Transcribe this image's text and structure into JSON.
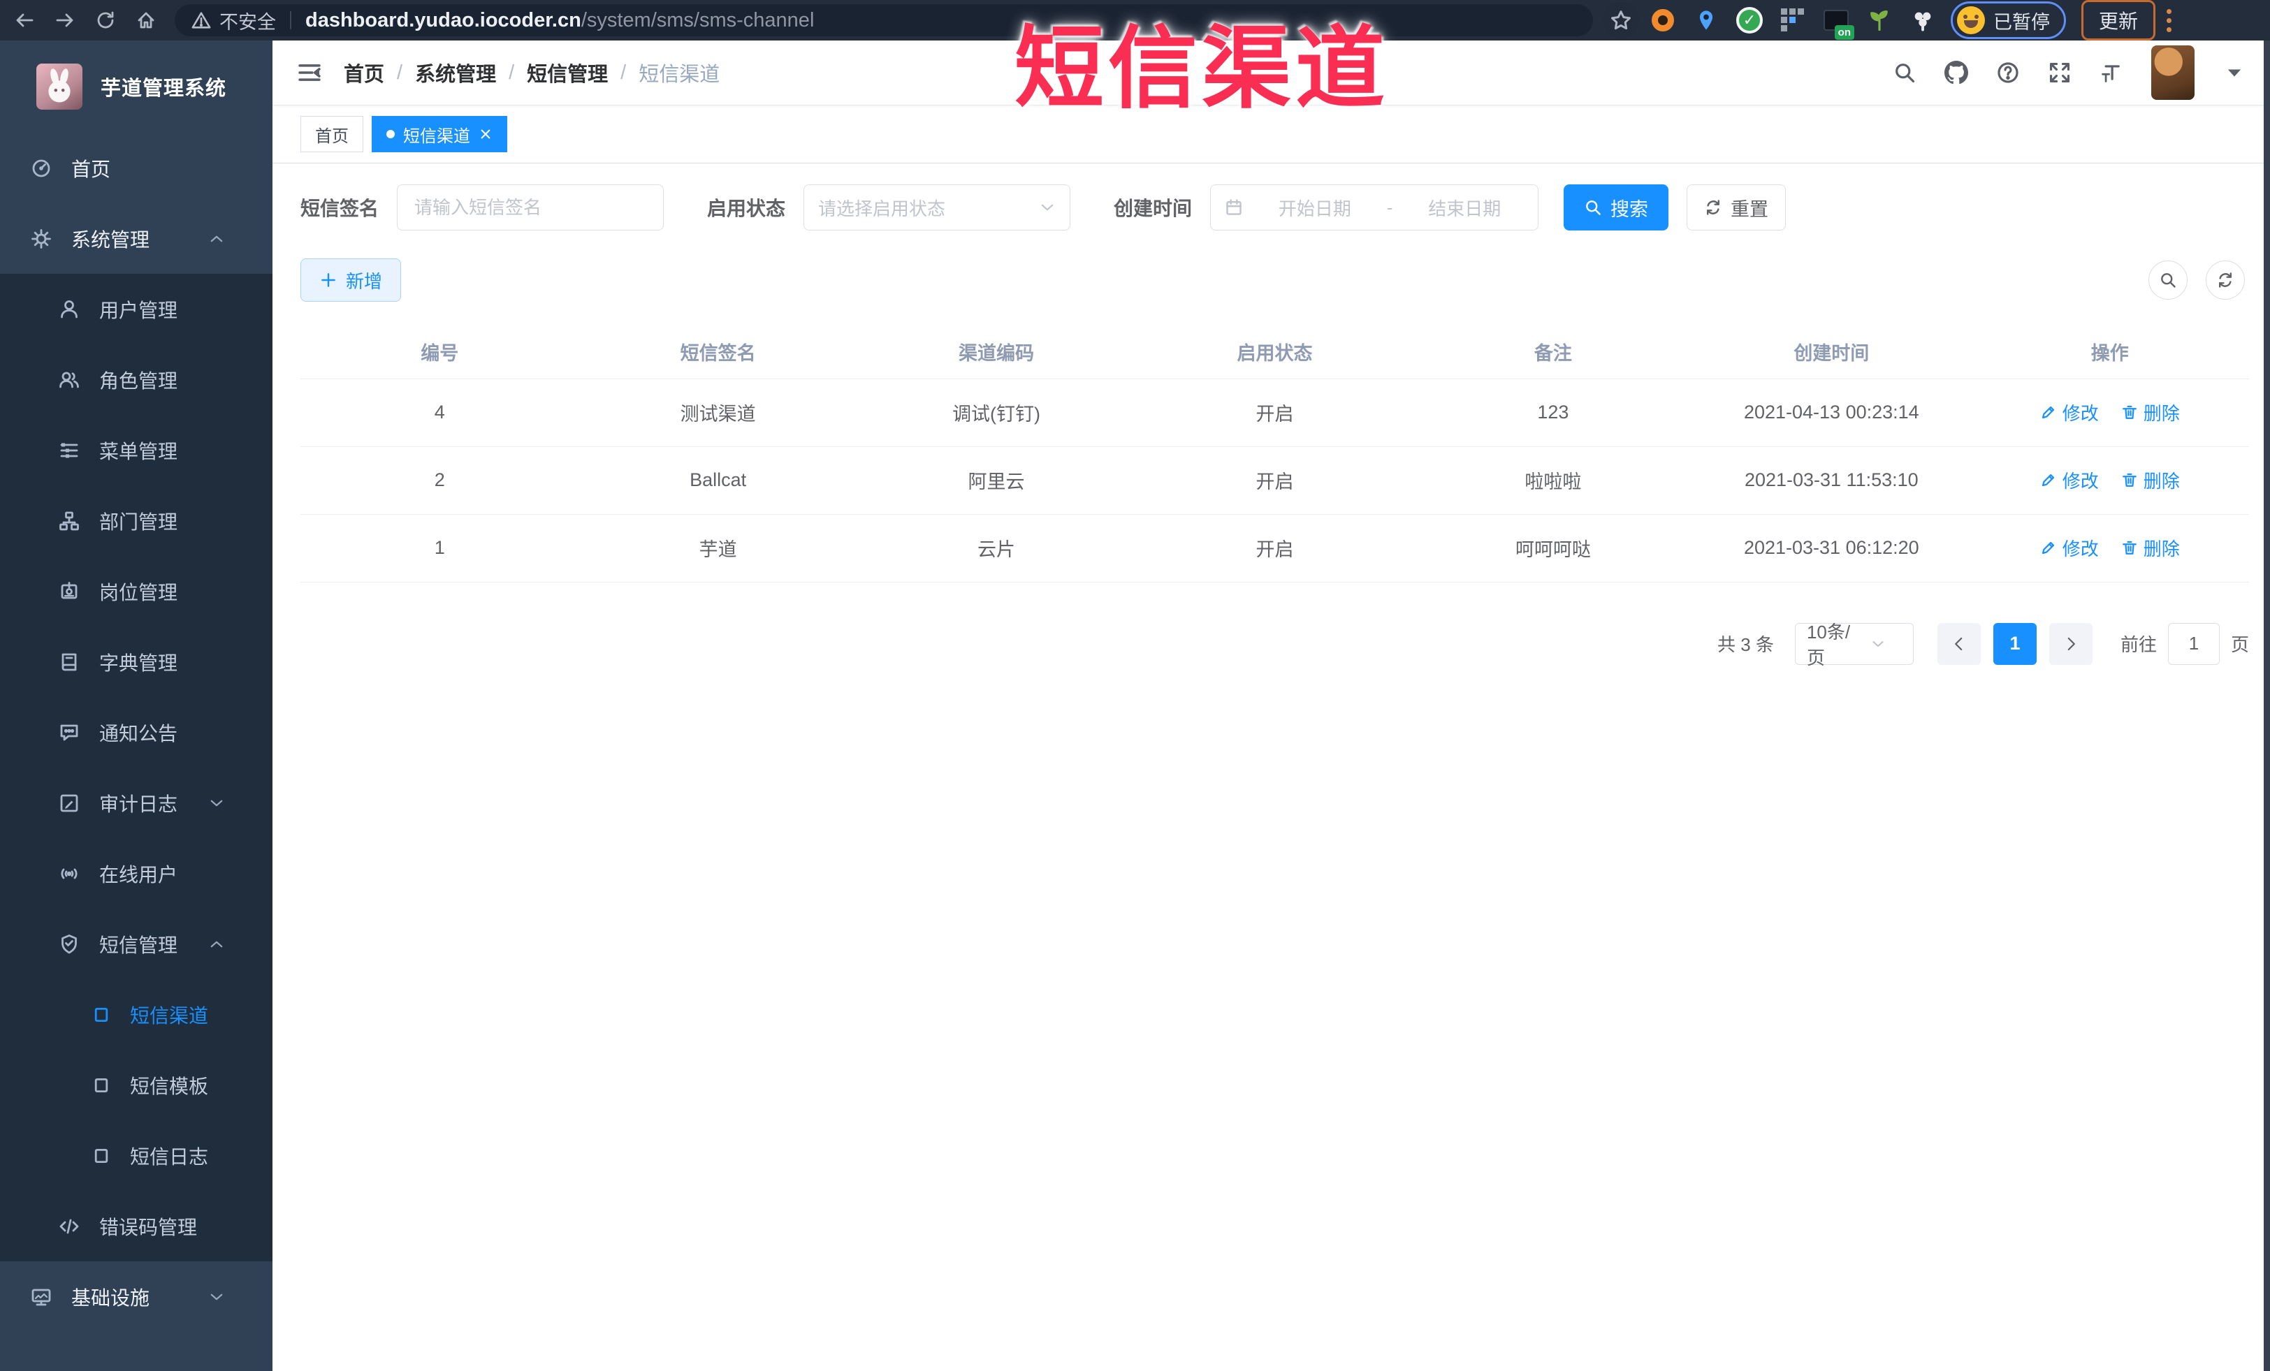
{
  "browser": {
    "security_label": "不安全",
    "url_host": "dashboard.yudao.iocoder.cn",
    "url_path": "/system/sms/sms-channel",
    "paused_badge": "已暂停",
    "update_button": "更新",
    "extension_on_badge": "on"
  },
  "annotation": {
    "text": "短信渠道"
  },
  "sidebar": {
    "title": "芋道管理系统",
    "items": [
      {
        "label": "首页",
        "icon": "dashboard",
        "level": 1
      },
      {
        "label": "系统管理",
        "icon": "gear",
        "level": 1,
        "chevron": "up"
      },
      {
        "label": "用户管理",
        "icon": "user",
        "level": 2
      },
      {
        "label": "角色管理",
        "icon": "peoples",
        "level": 2
      },
      {
        "label": "菜单管理",
        "icon": "tree-table",
        "level": 2
      },
      {
        "label": "部门管理",
        "icon": "tree",
        "level": 2
      },
      {
        "label": "岗位管理",
        "icon": "post",
        "level": 2
      },
      {
        "label": "字典管理",
        "icon": "dict",
        "level": 2
      },
      {
        "label": "通知公告",
        "icon": "message",
        "level": 2
      },
      {
        "label": "审计日志",
        "icon": "log",
        "level": 2,
        "chevron": "down"
      },
      {
        "label": "在线用户",
        "icon": "online",
        "level": 2
      },
      {
        "label": "短信管理",
        "icon": "sms-shield",
        "level": 2,
        "chevron": "up"
      },
      {
        "label": "短信渠道",
        "icon": "square",
        "level": 3,
        "active": true
      },
      {
        "label": "短信模板",
        "icon": "square",
        "level": 3
      },
      {
        "label": "短信日志",
        "icon": "square",
        "level": 3
      },
      {
        "label": "错误码管理",
        "icon": "code",
        "level": 2
      },
      {
        "label": "基础设施",
        "icon": "monitor",
        "level": 1,
        "chevron": "down"
      }
    ]
  },
  "header": {
    "breadcrumb": [
      "首页",
      "系统管理",
      "短信管理",
      "短信渠道"
    ]
  },
  "tabs": [
    {
      "label": "首页",
      "active": false
    },
    {
      "label": "短信渠道",
      "active": true
    }
  ],
  "filters": {
    "sign_label": "短信签名",
    "sign_placeholder": "请输入短信签名",
    "status_label": "启用状态",
    "status_placeholder": "请选择启用状态",
    "time_label": "创建时间",
    "date_start": "开始日期",
    "date_sep": "-",
    "date_end": "结束日期",
    "search_button": "搜索",
    "reset_button": "重置"
  },
  "toolbar": {
    "add_button": "新增"
  },
  "table": {
    "headers": [
      "编号",
      "短信签名",
      "渠道编码",
      "启用状态",
      "备注",
      "创建时间",
      "操作"
    ],
    "rows": [
      {
        "no": "4",
        "sign": "测试渠道",
        "code": "调试(钉钉)",
        "status": "开启",
        "remark": "123",
        "time": "2021-04-13 00:23:14"
      },
      {
        "no": "2",
        "sign": "Ballcat",
        "code": "阿里云",
        "status": "开启",
        "remark": "啦啦啦",
        "time": "2021-03-31 11:53:10"
      },
      {
        "no": "1",
        "sign": "芋道",
        "code": "云片",
        "status": "开启",
        "remark": "呵呵呵哒",
        "time": "2021-03-31 06:12:20"
      }
    ],
    "edit_label": "修改",
    "delete_label": "删除"
  },
  "pagination": {
    "total": "共 3 条",
    "page_size": "10条/页",
    "page": "1",
    "goto": "前往",
    "goto_value": "1",
    "unit": "页"
  },
  "colors": {
    "accent": "#1890ff",
    "annotation": "#fa2e53",
    "sidebar_bg": "#304156",
    "submenu_bg": "#1f2d3d"
  }
}
